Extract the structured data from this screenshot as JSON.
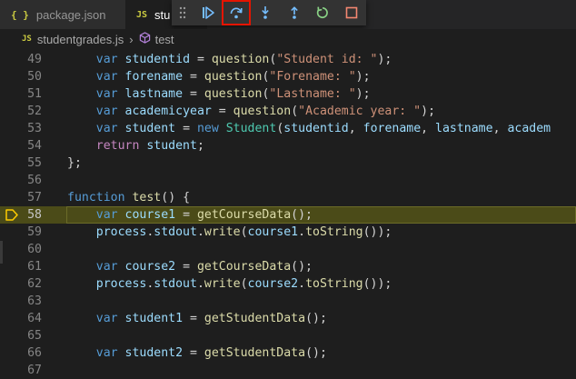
{
  "tabs": [
    {
      "label": "package.json",
      "icon": "json-braces-icon"
    },
    {
      "label": "stu",
      "icon": "js-icon"
    }
  ],
  "debug_toolbar": {
    "buttons": [
      {
        "name": "continue",
        "color": "#75beff"
      },
      {
        "name": "step-over",
        "color": "#75beff",
        "highlighted": true
      },
      {
        "name": "step-into",
        "color": "#75beff"
      },
      {
        "name": "step-out",
        "color": "#75beff"
      },
      {
        "name": "restart",
        "color": "#89d185"
      },
      {
        "name": "stop",
        "color": "#f48771"
      }
    ]
  },
  "breadcrumb": {
    "file_icon": "JS",
    "file": "studentgrades.js",
    "symbol": "test"
  },
  "editor": {
    "current_line": 58,
    "breakpoint_color": "#ffcc00",
    "lines": [
      {
        "n": "49",
        "tokens": [
          [
            "",
            "    "
          ],
          [
            "kw",
            "var"
          ],
          [
            "",
            " "
          ],
          [
            "var",
            "studentid"
          ],
          [
            "",
            " = "
          ],
          [
            "fn",
            "question"
          ],
          [
            "",
            "("
          ],
          [
            "str",
            "\"Student id: \""
          ],
          [
            "",
            ");"
          ]
        ]
      },
      {
        "n": "50",
        "tokens": [
          [
            "",
            "    "
          ],
          [
            "kw",
            "var"
          ],
          [
            "",
            " "
          ],
          [
            "var",
            "forename"
          ],
          [
            "",
            " = "
          ],
          [
            "fn",
            "question"
          ],
          [
            "",
            "("
          ],
          [
            "str",
            "\"Forename: \""
          ],
          [
            "",
            ");"
          ]
        ]
      },
      {
        "n": "51",
        "tokens": [
          [
            "",
            "    "
          ],
          [
            "kw",
            "var"
          ],
          [
            "",
            " "
          ],
          [
            "var",
            "lastname"
          ],
          [
            "",
            " = "
          ],
          [
            "fn",
            "question"
          ],
          [
            "",
            "("
          ],
          [
            "str",
            "\"Lastname: \""
          ],
          [
            "",
            ");"
          ]
        ]
      },
      {
        "n": "52",
        "tokens": [
          [
            "",
            "    "
          ],
          [
            "kw",
            "var"
          ],
          [
            "",
            " "
          ],
          [
            "var",
            "academicyear"
          ],
          [
            "",
            " = "
          ],
          [
            "fn",
            "question"
          ],
          [
            "",
            "("
          ],
          [
            "str",
            "\"Academic year: \""
          ],
          [
            "",
            ");"
          ]
        ]
      },
      {
        "n": "53",
        "tokens": [
          [
            "",
            "    "
          ],
          [
            "kw",
            "var"
          ],
          [
            "",
            " "
          ],
          [
            "var",
            "student"
          ],
          [
            "",
            " = "
          ],
          [
            "kw",
            "new"
          ],
          [
            "",
            " "
          ],
          [
            "cls",
            "Student"
          ],
          [
            "",
            "("
          ],
          [
            "var",
            "studentid"
          ],
          [
            "",
            ", "
          ],
          [
            "var",
            "forename"
          ],
          [
            "",
            ", "
          ],
          [
            "var",
            "lastname"
          ],
          [
            "",
            ", "
          ],
          [
            "var",
            "academ"
          ]
        ]
      },
      {
        "n": "54",
        "tokens": [
          [
            "",
            "    "
          ],
          [
            "kw2",
            "return"
          ],
          [
            "",
            " "
          ],
          [
            "var",
            "student"
          ],
          [
            "",
            ";"
          ]
        ]
      },
      {
        "n": "55",
        "tokens": [
          [
            "",
            "};"
          ]
        ]
      },
      {
        "n": "56",
        "tokens": []
      },
      {
        "n": "57",
        "tokens": [
          [
            "kw",
            "function"
          ],
          [
            "",
            " "
          ],
          [
            "fn",
            "test"
          ],
          [
            "",
            "() {"
          ]
        ]
      },
      {
        "n": "58",
        "tokens": [
          [
            "",
            "    "
          ],
          [
            "kw",
            "var"
          ],
          [
            "",
            " "
          ],
          [
            "var",
            "course1"
          ],
          [
            "",
            " = "
          ],
          [
            "fn",
            "getCourseData"
          ],
          [
            "",
            "();"
          ]
        ]
      },
      {
        "n": "59",
        "tokens": [
          [
            "",
            "    "
          ],
          [
            "var",
            "process"
          ],
          [
            "",
            "."
          ],
          [
            "var",
            "stdout"
          ],
          [
            "",
            "."
          ],
          [
            "fn",
            "write"
          ],
          [
            "",
            "("
          ],
          [
            "var",
            "course1"
          ],
          [
            "",
            "."
          ],
          [
            "fn",
            "toString"
          ],
          [
            "",
            "());"
          ]
        ]
      },
      {
        "n": "60",
        "tokens": []
      },
      {
        "n": "61",
        "tokens": [
          [
            "",
            "    "
          ],
          [
            "kw",
            "var"
          ],
          [
            "",
            " "
          ],
          [
            "var",
            "course2"
          ],
          [
            "",
            " = "
          ],
          [
            "fn",
            "getCourseData"
          ],
          [
            "",
            "();"
          ]
        ]
      },
      {
        "n": "62",
        "tokens": [
          [
            "",
            "    "
          ],
          [
            "var",
            "process"
          ],
          [
            "",
            "."
          ],
          [
            "var",
            "stdout"
          ],
          [
            "",
            "."
          ],
          [
            "fn",
            "write"
          ],
          [
            "",
            "("
          ],
          [
            "var",
            "course2"
          ],
          [
            "",
            "."
          ],
          [
            "fn",
            "toString"
          ],
          [
            "",
            "());"
          ]
        ]
      },
      {
        "n": "63",
        "tokens": []
      },
      {
        "n": "64",
        "tokens": [
          [
            "",
            "    "
          ],
          [
            "kw",
            "var"
          ],
          [
            "",
            " "
          ],
          [
            "var",
            "student1"
          ],
          [
            "",
            " = "
          ],
          [
            "fn",
            "getStudentData"
          ],
          [
            "",
            "();"
          ]
        ]
      },
      {
        "n": "65",
        "tokens": []
      },
      {
        "n": "66",
        "tokens": [
          [
            "",
            "    "
          ],
          [
            "kw",
            "var"
          ],
          [
            "",
            " "
          ],
          [
            "var",
            "student2"
          ],
          [
            "",
            " = "
          ],
          [
            "fn",
            "getStudentData"
          ],
          [
            "",
            "();"
          ]
        ]
      },
      {
        "n": "67",
        "tokens": []
      }
    ]
  }
}
